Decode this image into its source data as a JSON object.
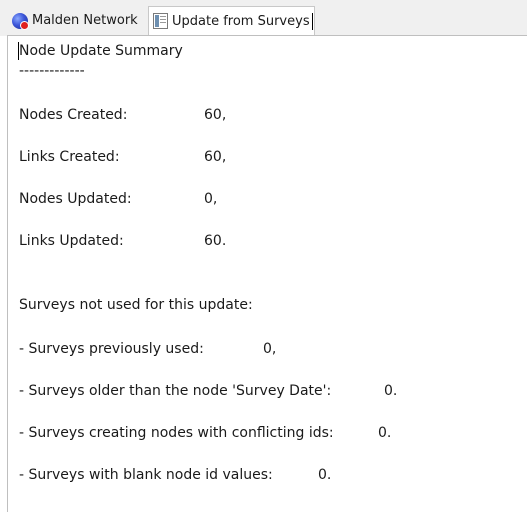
{
  "tabs": [
    {
      "label": "Malden Network",
      "icon": "globe-icon",
      "active": false
    },
    {
      "label": "Update from Surveys",
      "icon": "document-icon",
      "active": true
    }
  ],
  "summary": {
    "title": "Node Update Summary",
    "underline": "-------------",
    "stats": [
      {
        "label": "Nodes Created:",
        "value": "60,"
      },
      {
        "label": "Links Created:",
        "value": "60,"
      },
      {
        "label": "Nodes Updated:",
        "value": "0,"
      },
      {
        "label": "Links Updated:",
        "value": "60."
      }
    ],
    "unused_heading": "Surveys not used for this update:",
    "unused": [
      {
        "label": "- Surveys previously used:",
        "value": "0,"
      },
      {
        "label": "- Surveys older than the node 'Survey Date':",
        "value": "0."
      },
      {
        "label": "- Surveys creating nodes with conflicting ids:",
        "value": "0."
      },
      {
        "label": "- Surveys with blank node id values:",
        "value": "0."
      }
    ]
  },
  "colors": {
    "tab_strip": "#f0f0f0",
    "panel": "#ffffff",
    "text": "#1a1a1a"
  }
}
